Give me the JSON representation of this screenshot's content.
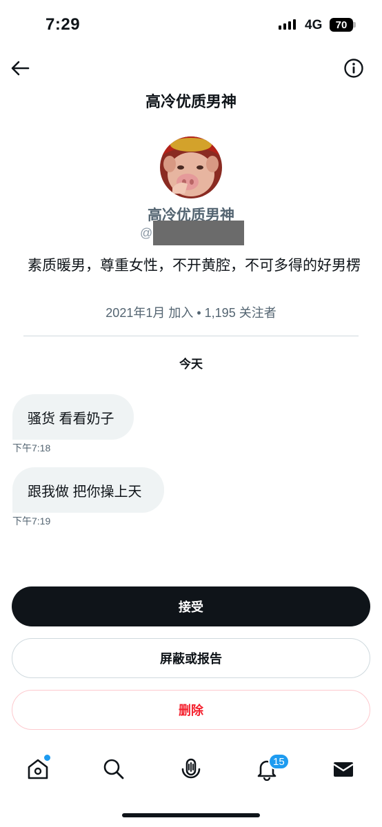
{
  "status_bar": {
    "time": "7:29",
    "network": "4G",
    "battery": "70"
  },
  "header": {
    "title": "高冷优质男神",
    "back_icon": "arrow-left-icon",
    "info_icon": "info-icon"
  },
  "profile": {
    "display_name": "高冷优质男神",
    "handle_prefix": "@",
    "bio": "素质暖男，尊重女性，不开黄腔，不可多得的好男楞",
    "meta": "2021年1月 加入 • 1,195 关注者"
  },
  "conversation": {
    "day_label": "今天",
    "messages": [
      {
        "text": "骚货 看看奶子",
        "time": "下午7:18"
      },
      {
        "text": "跟我做 把你操上天",
        "time": "下午7:19"
      }
    ]
  },
  "actions": {
    "accept": "接受",
    "block_report": "屏蔽或报告",
    "delete": "删除"
  },
  "bottom_nav": {
    "items": [
      "home-icon",
      "search-icon",
      "spaces-icon",
      "notifications-icon",
      "messages-icon"
    ],
    "notifications_badge": "15"
  },
  "colors": {
    "accent": "#1d9bf0",
    "danger": "#f4212e",
    "primary_button": "#0f1419",
    "bubble": "#eff3f4"
  }
}
